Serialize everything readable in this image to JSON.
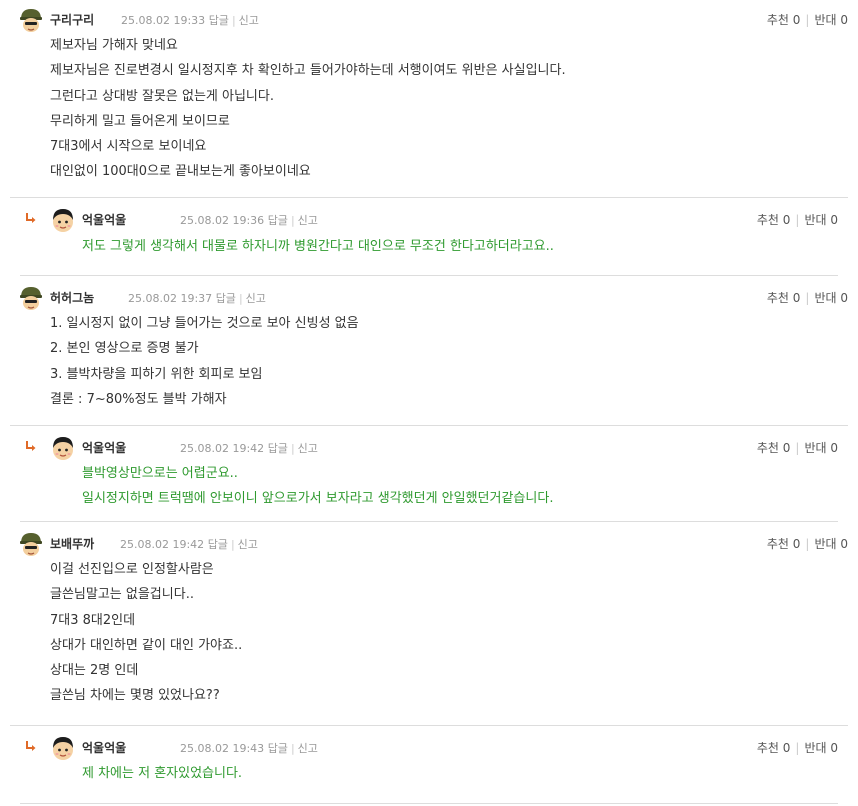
{
  "colors": {
    "reply_text": "#2f9a2f",
    "meta_text": "#999999",
    "divider": "#dddddd",
    "reply_arrow": "#e06a28"
  },
  "comments": [
    {
      "nick": "구리구리",
      "date": "25.08.02 19:33",
      "reply_label": "답글",
      "report_label": "신고",
      "recommend_label": "추천",
      "recommend_count": "0",
      "oppose_label": "반대",
      "oppose_count": "0",
      "avatar_icon": "soldier-helmet-avatar-icon",
      "lines": [
        "제보자님 가해자 맞네요",
        "제보자님은 진로변경시 일시정지후 차 확인하고 들어가야하는데 서행이여도 위반은 사실입니다.",
        "그런다고 상대방 잘못은 없는게 아닙니다.",
        "무리하게 밀고 들어온게 보이므로",
        "7대3에서 시작으로 보이네요",
        "대인없이 100대0으로 끝내보는게 좋아보이네요"
      ]
    },
    {
      "nick": "억울억울",
      "date": "25.08.02 19:36",
      "reply_label": "답글",
      "report_label": "신고",
      "recommend_label": "추천",
      "recommend_count": "0",
      "oppose_label": "반대",
      "oppose_count": "0",
      "avatar_icon": "boy-avatar-icon",
      "lines": [
        "저도 그렇게 생각해서 대물로 하자니까 병원간다고 대인으로 무조건 한다고하더라고요.."
      ]
    },
    {
      "nick": "허허그놈",
      "date": "25.08.02 19:37",
      "reply_label": "답글",
      "report_label": "신고",
      "recommend_label": "추천",
      "recommend_count": "0",
      "oppose_label": "반대",
      "oppose_count": "0",
      "avatar_icon": "soldier-helmet-avatar-icon",
      "lines": [
        "1. 일시정지 없이 그냥 들어가는 것으로 보아 신빙성 없음",
        "2. 본인 영상으로 증명 불가",
        "3. 블박차량을 피하기 위한 회피로 보임",
        "결론 : 7~80%정도 블박 가해자"
      ]
    },
    {
      "nick": "억울억울",
      "date": "25.08.02 19:42",
      "reply_label": "답글",
      "report_label": "신고",
      "recommend_label": "추천",
      "recommend_count": "0",
      "oppose_label": "반대",
      "oppose_count": "0",
      "avatar_icon": "boy-avatar-icon",
      "lines": [
        "블박영상만으로는 어렵군요..",
        "일시정지하면 트럭땜에 안보이니 앞으로가서 보자라고 생각했던게 안일했던거같습니다."
      ]
    },
    {
      "nick": "보배뚜까",
      "date": "25.08.02 19:42",
      "reply_label": "답글",
      "report_label": "신고",
      "recommend_label": "추천",
      "recommend_count": "0",
      "oppose_label": "반대",
      "oppose_count": "0",
      "avatar_icon": "soldier-helmet-avatar-icon",
      "lines": [
        "이걸 선진입으로 인정할사람은",
        "글쓴님말고는 없을겁니다..",
        "7대3 8대2인데",
        "상대가 대인하면 같이 대인 가야죠..",
        "상대는 2명 인데",
        "글쓴님 차에는 몇명 있었나요??"
      ]
    },
    {
      "nick": "억울억울",
      "date": "25.08.02 19:43",
      "reply_label": "답글",
      "report_label": "신고",
      "recommend_label": "추천",
      "recommend_count": "0",
      "oppose_label": "반대",
      "oppose_count": "0",
      "avatar_icon": "boy-avatar-icon",
      "lines": [
        "제 차에는 저 혼자있었습니다."
      ]
    }
  ]
}
